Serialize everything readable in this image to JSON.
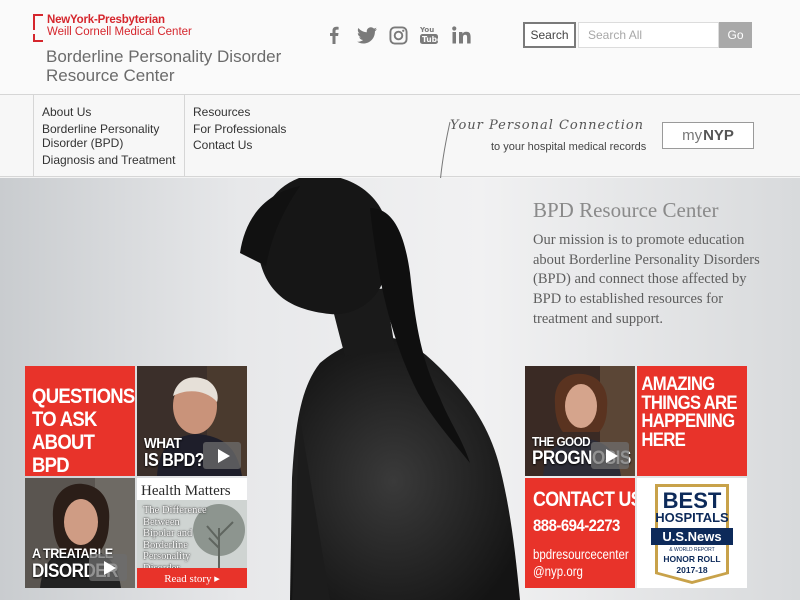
{
  "logo": {
    "line1": "NewYork-Presbyterian",
    "line2": "Weill Cornell Medical Center"
  },
  "site_title": "Borderline Personality Disorder Resource Center",
  "search": {
    "button_label": "Search",
    "placeholder": "Search All",
    "go_label": "Go"
  },
  "social_icons": [
    "facebook-icon",
    "twitter-icon",
    "instagram-icon",
    "youtube-icon",
    "linkedin-icon"
  ],
  "nav": {
    "col1": [
      "About Us",
      "Borderline Personality Disorder (BPD)",
      "Diagnosis and Treatment"
    ],
    "col2": [
      "Resources",
      "For Professionals",
      "Contact Us"
    ]
  },
  "mynyp": {
    "script": "Your Personal Connection",
    "sub": "to your hospital medical records",
    "logo_prefix": "my",
    "logo_brand": "NYP"
  },
  "hero": {
    "title": "BPD Resource Center",
    "mission": "Our mission is to promote education about Borderline Personality Disorders (BPD) and connect those affected by BPD to established resources for treatment and support."
  },
  "tiles": {
    "questions": "Questions to Ask About BPD",
    "what_is": {
      "line1": "What",
      "line2": "is BPD?"
    },
    "treatable": {
      "line1": "A Treatable",
      "line2": "Disorder"
    },
    "health_matters": {
      "title": "Health Matters",
      "text": "The Difference Between Bipolar and Borderline Personality Disorder",
      "read": "Read story ▸"
    },
    "good_prognosis": {
      "line1": "The Good",
      "line2": "Prognosis"
    },
    "amazing": "Amazing Things Are Happening Here",
    "contact": {
      "title": "CONTACT US",
      "phone": "888-694-2273",
      "email_line1": "bpdresourcecenter",
      "email_line2": "@nyp.org"
    },
    "best_hospitals": {
      "line1": "BEST",
      "line2": "HOSPITALS",
      "brand": "U.S.News",
      "sub": "& WORLD REPORT",
      "honor": "HONOR ROLL",
      "year": "2017-18"
    }
  },
  "colors": {
    "brand_red": "#e8332a",
    "nyp_red": "#d5262d",
    "text_gray": "#6b6b6b"
  }
}
